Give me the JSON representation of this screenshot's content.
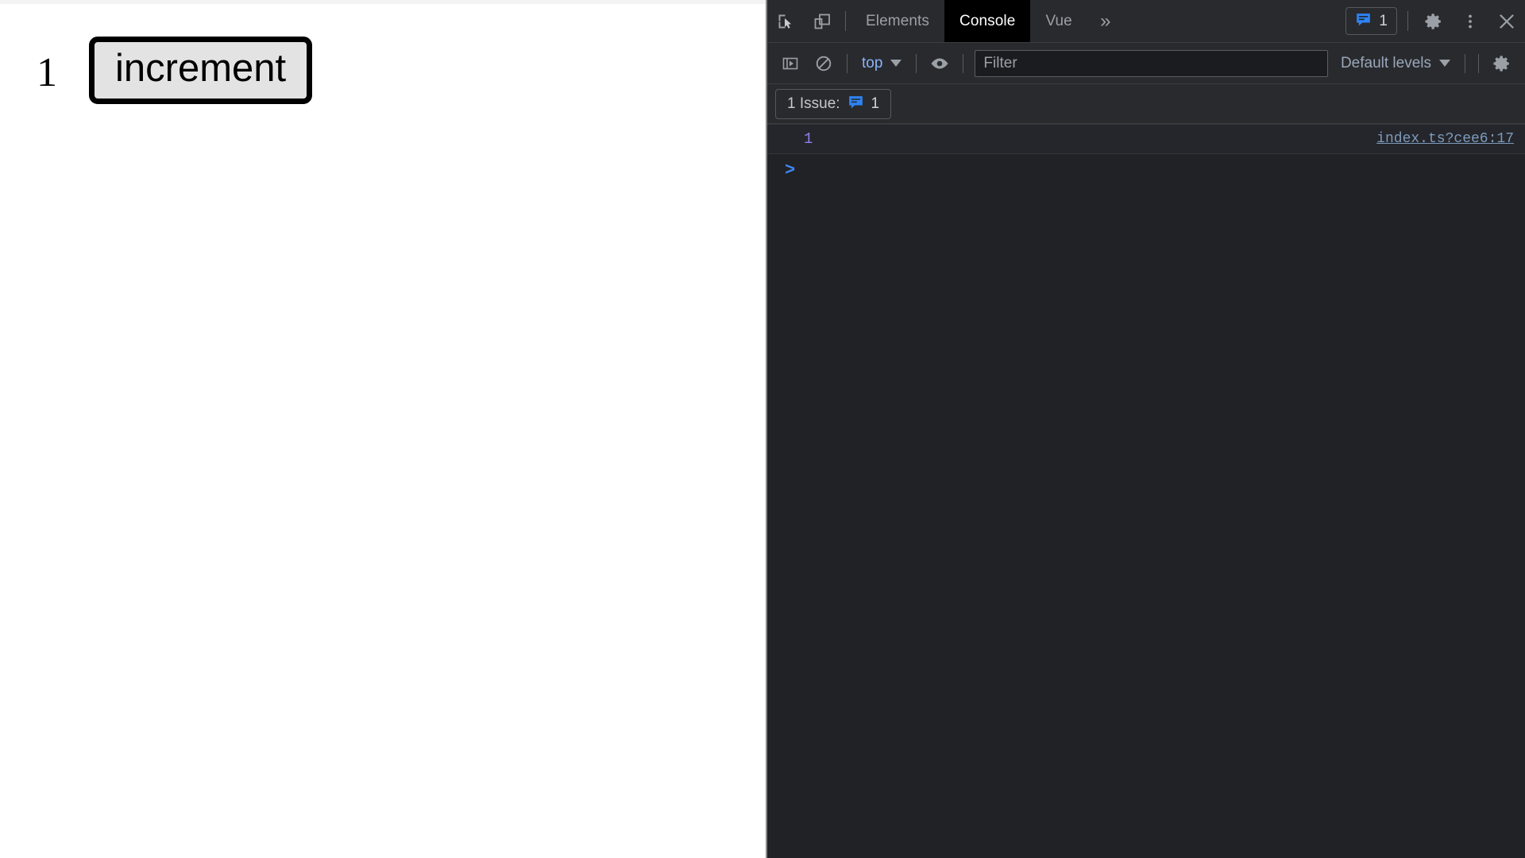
{
  "page": {
    "counter_value": "1",
    "increment_button_label": "increment"
  },
  "devtools": {
    "tabbar": {
      "inspect_icon": "inspect-element-icon",
      "device_icon": "device-toolbar-icon",
      "tabs": [
        {
          "label": "Elements",
          "active": false
        },
        {
          "label": "Console",
          "active": true
        },
        {
          "label": "Vue",
          "active": false
        }
      ],
      "more_tabs_label": "»",
      "issues_count": "1",
      "issues_icon": "message-bubble-icon",
      "settings_icon": "gear-icon",
      "menu_icon": "kebab-menu-icon",
      "close_icon": "close-icon"
    },
    "toolbar": {
      "sidebar_icon": "console-sidebar-icon",
      "clear_icon": "clear-console-icon",
      "context_label": "top",
      "eye_icon": "live-expression-eye-icon",
      "filter_placeholder": "Filter",
      "filter_value": "",
      "levels_label": "Default levels",
      "settings_icon": "gear-icon"
    },
    "issues_bar": {
      "label": "1 Issue:",
      "icon": "message-bubble-icon",
      "count": "1"
    },
    "console": {
      "messages": [
        {
          "value": "1",
          "source": "index.ts?cee6:17"
        }
      ],
      "prompt_symbol": ">"
    }
  },
  "colors": {
    "accent_blue": "#3e87f5",
    "link_blue": "#8ab4f8",
    "number_violet": "#8f7ff0",
    "panel_bg": "#212226",
    "toolbar_bg": "#292a2e",
    "button_face": "#e3e3e3"
  }
}
